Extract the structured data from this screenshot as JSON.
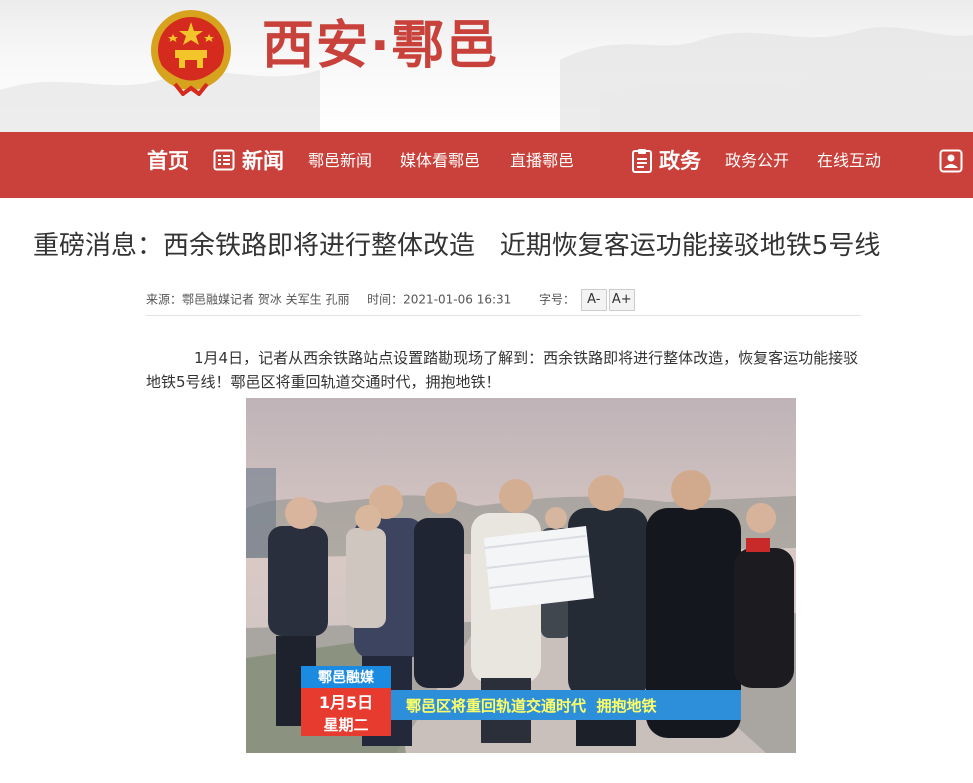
{
  "site": {
    "title": "西安·鄠邑"
  },
  "nav": {
    "home": "首页",
    "news": "新闻",
    "local_news": "鄠邑新闻",
    "media": "媒体看鄠邑",
    "live": "直播鄠邑",
    "gov": "政务",
    "gov_open": "政务公开",
    "online": "在线互动"
  },
  "article": {
    "title": "重磅消息：西余铁路即将进行整体改造   近期恢复客运功能接驳地铁5号线",
    "source_label": "来源：",
    "source": "鄠邑融媒记者 贺冰 关军生 孔丽",
    "time_label": "时间：",
    "time": "2021-01-06 16:31",
    "fontsize_label": "字号：",
    "font_minus": "A-",
    "font_plus": "A+",
    "paragraph": "1月4日，记者从西余铁路站点设置踏勘现场了解到：西余铁路即将进行整体改造，恢复客运功能接驳地铁5号线！鄠邑区将重回轨道交通时代，拥抱地铁！"
  },
  "photo_caption": {
    "logo": "鄠邑融媒",
    "date": "1月5日",
    "weekday": "星期二",
    "banner": "鄠邑区将重回轨道交通时代  拥抱地铁"
  },
  "colors": {
    "brand_red": "#c9413a",
    "title_red": "#c8413a"
  }
}
